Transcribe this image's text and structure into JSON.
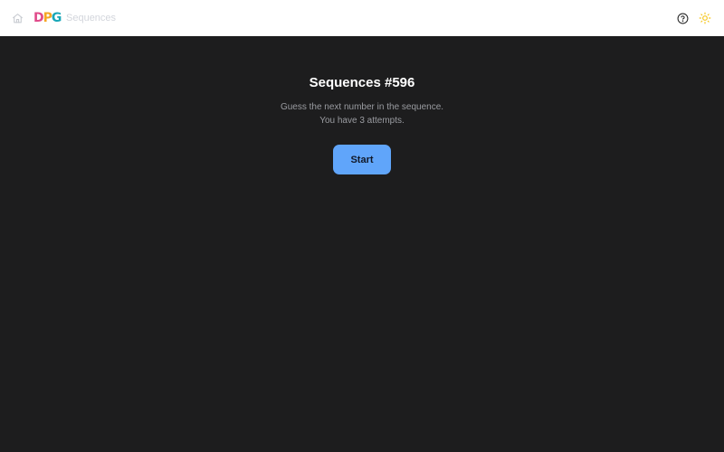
{
  "header": {
    "logo_letters": [
      "D",
      "P",
      "G"
    ],
    "logo_colors": [
      "#e04a8a",
      "#f5a623",
      "#19a7b8"
    ],
    "breadcrumb": "Sequences",
    "home_icon": "home-icon",
    "help_icon": "help-circle-icon",
    "theme_icon": "sun-icon"
  },
  "game": {
    "title": "Sequences #596",
    "description_line1": "Guess the next number in the sequence.",
    "description_line2": "You have 3 attempts.",
    "start_label": "Start"
  },
  "colors": {
    "background": "#1d1d1e",
    "header_bg": "#ffffff",
    "accent": "#60a5fa",
    "sun": "#f5c518"
  }
}
